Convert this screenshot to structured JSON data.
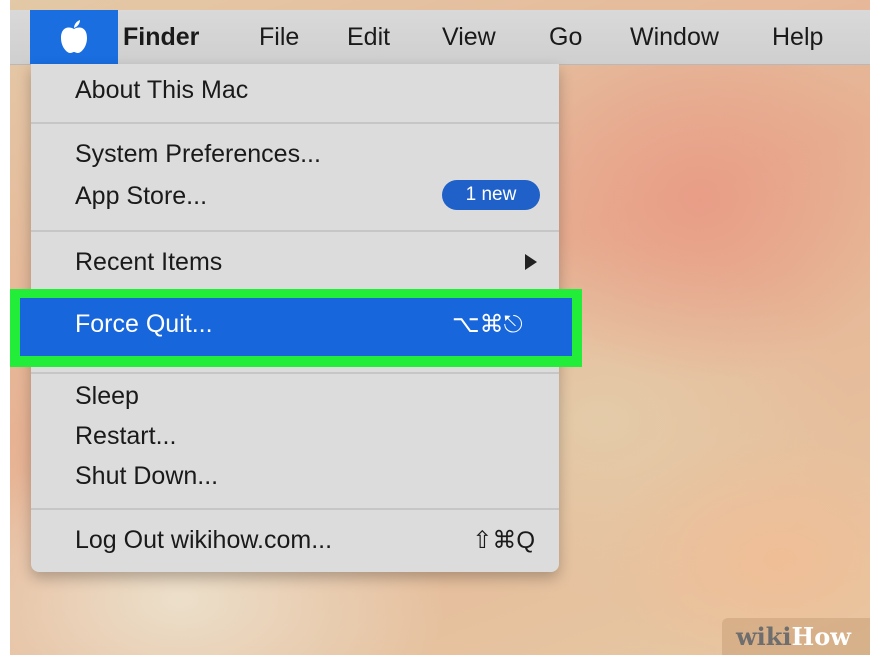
{
  "menubar": {
    "apple_icon": "apple-logo",
    "items": [
      "Finder",
      "File",
      "Edit",
      "View",
      "Go",
      "Window",
      "Help"
    ]
  },
  "apple_menu": {
    "about": "About This Mac",
    "system_preferences": "System Preferences...",
    "app_store": "App Store...",
    "app_store_badge": "1 new",
    "recent_items": "Recent Items",
    "force_quit": "Force Quit...",
    "force_quit_shortcut": "⌥⌘⎋",
    "sleep": "Sleep",
    "restart": "Restart...",
    "shut_down": "Shut Down...",
    "log_out": "Log Out wikihow.com...",
    "log_out_shortcut": "⇧⌘Q"
  },
  "highlight": {
    "color": "#22ee3a",
    "selected_item": "Force Quit..."
  },
  "watermark": {
    "part1": "wiki",
    "part2": "How"
  }
}
